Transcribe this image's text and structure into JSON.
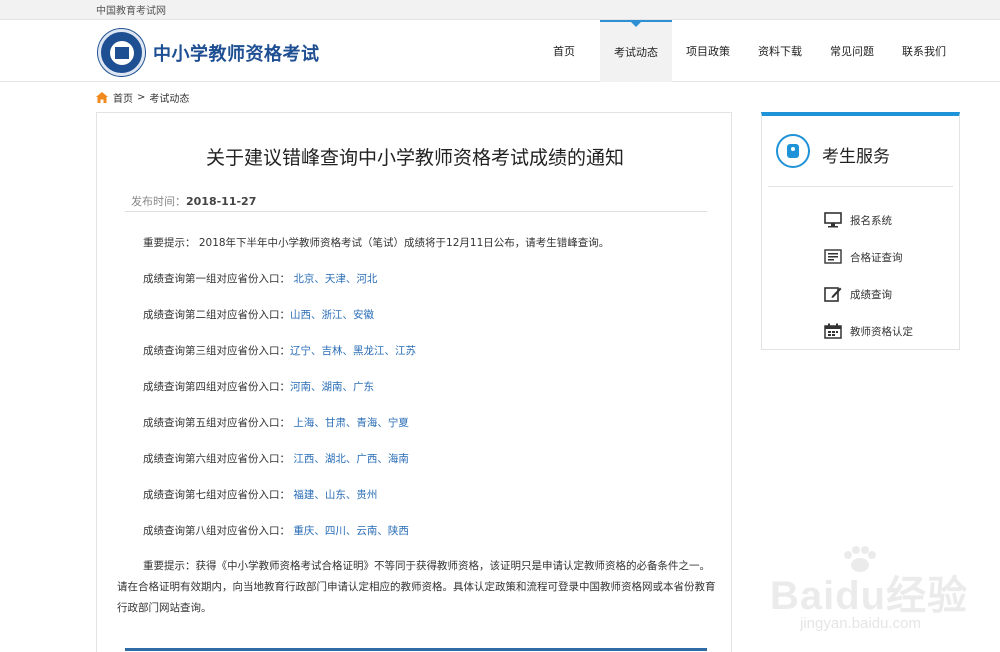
{
  "topbar": {
    "site_link": "中国教育考试网"
  },
  "header": {
    "site_name": "中小学教师资格考试",
    "nav": [
      "首页",
      "考试动态",
      "项目政策",
      "资料下载",
      "常见问题",
      "联系我们"
    ],
    "active_nav": "考试动态"
  },
  "breadcrumb": {
    "home": "首页",
    "separator": ">",
    "current": "考试动态"
  },
  "article": {
    "title": "关于建议错峰查询中小学教师资格考试成绩的通知",
    "publish_label": "发布时间：",
    "publish_date": "2018-11-27",
    "intro": "重要提示： 2018年下半年中小学教师资格考试（笔试）成绩将于12月11日公布，请考生错峰查询。",
    "groups": [
      {
        "label": "成绩查询第一组对应省份入口：",
        "provinces": " 北京、天津、河北"
      },
      {
        "label": "成绩查询第二组对应省份入口：",
        "provinces": "山西、浙江、安徽"
      },
      {
        "label": "成绩查询第三组对应省份入口：",
        "provinces": "辽宁、吉林、黑龙江、江苏"
      },
      {
        "label": "成绩查询第四组对应省份入口：",
        "provinces": "河南、湖南、广东"
      },
      {
        "label": "成绩查询第五组对应省份入口：",
        "provinces": " 上海、甘肃、青海、宁夏"
      },
      {
        "label": "成绩查询第六组对应省份入口：",
        "provinces": " 江西、湖北、广西、海南"
      },
      {
        "label": "成绩查询第七组对应省份入口：",
        "provinces": " 福建、山东、贵州"
      },
      {
        "label": "成绩查询第八组对应省份入口：",
        "provinces": " 重庆、四川、云南、陕西"
      }
    ],
    "notice": "重要提示：获得《中小学教师资格考试合格证明》不等同于获得教师资格，该证明只是申请认定教师资格的必备条件之一。请在合格证明有效期内，向当地教育行政部门申请认定相应的教师资格。具体认定政策和流程可登录中国教师资格网或本省份教育行政部门网站查询。"
  },
  "sidebar": {
    "title": "考生服务",
    "items": [
      {
        "label": "报名系统",
        "icon": "monitor-icon"
      },
      {
        "label": "合格证查询",
        "icon": "certificate-icon"
      },
      {
        "label": "成绩查询",
        "icon": "edit-icon"
      },
      {
        "label": "教师资格认定",
        "icon": "calendar-icon"
      }
    ]
  },
  "watermark": {
    "brand": "Baidu经验",
    "url": "jingyan.baidu.com"
  },
  "colors": {
    "brand": "#1f4f93",
    "accent": "#1f93d8",
    "link": "#2a6db6"
  }
}
